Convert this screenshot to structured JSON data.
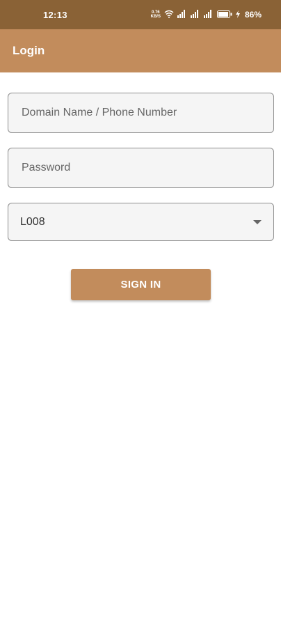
{
  "status_bar": {
    "time": "12:13",
    "net_speed_value": "0.76",
    "net_speed_unit": "KB/S",
    "battery_percent": "86%"
  },
  "app_bar": {
    "title": "Login"
  },
  "form": {
    "domain_placeholder": "Domain Name / Phone Number",
    "password_placeholder": "Password",
    "location_value": "L008",
    "sign_in_label": "SIGN IN"
  },
  "colors": {
    "status_bar": "#8a6236",
    "app_bar": "#c28c5c",
    "button": "#c28c5c"
  },
  "icons": [
    "wifi-icon",
    "signal-icon",
    "battery-icon",
    "charging-icon",
    "chevron-down-icon"
  ]
}
